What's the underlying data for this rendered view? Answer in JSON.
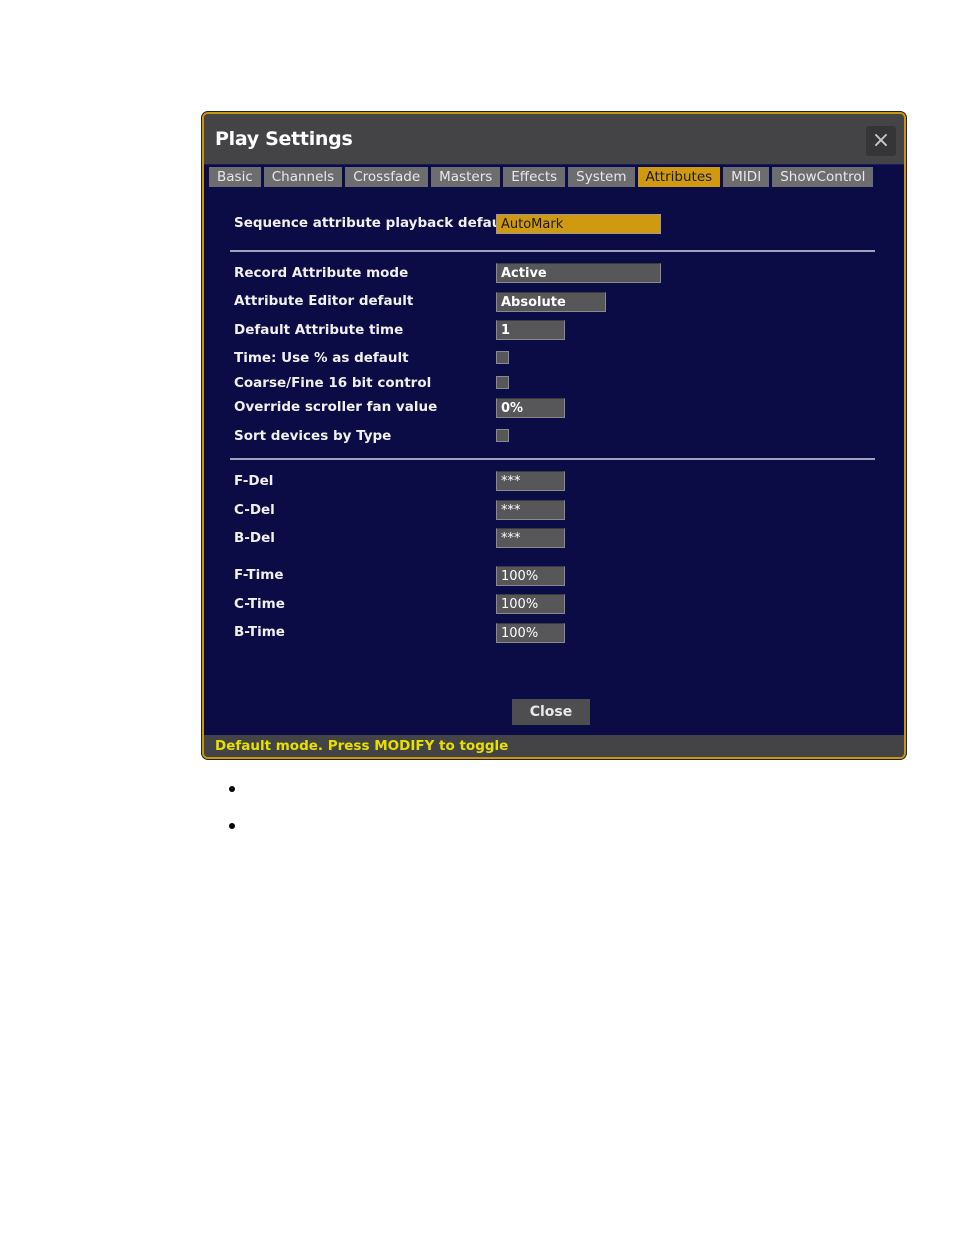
{
  "dialog": {
    "title": "Play Settings",
    "close_icon": "×",
    "tabs": [
      {
        "label": "Basic",
        "active": false
      },
      {
        "label": "Channels",
        "active": false
      },
      {
        "label": "Crossfade",
        "active": false
      },
      {
        "label": "Masters",
        "active": false
      },
      {
        "label": "Effects",
        "active": false
      },
      {
        "label": "System",
        "active": false
      },
      {
        "label": "Attributes",
        "active": true
      },
      {
        "label": "MIDI",
        "active": false
      },
      {
        "label": "ShowControl",
        "active": false
      }
    ],
    "settings": {
      "sequence_playback_default": {
        "label": "Sequence attribute playback default",
        "value": "AutoMark"
      },
      "record_attribute_mode": {
        "label": "Record Attribute mode",
        "value": "Active"
      },
      "attribute_editor_default": {
        "label": "Attribute Editor default",
        "value": "Absolute"
      },
      "default_attribute_time": {
        "label": "Default Attribute time",
        "value": "1"
      },
      "time_use_percent": {
        "label": "Time: Use % as default",
        "checked": false
      },
      "coarse_fine": {
        "label": "Coarse/Fine 16 bit control",
        "checked": false
      },
      "override_scroller_fan": {
        "label": "Override scroller fan value",
        "value": "0%"
      },
      "sort_devices": {
        "label": "Sort devices by Type",
        "checked": false
      },
      "f_del": {
        "label": "F-Del",
        "value": "***"
      },
      "c_del": {
        "label": "C-Del",
        "value": "***"
      },
      "b_del": {
        "label": "B-Del",
        "value": "***"
      },
      "f_time": {
        "label": "F-Time",
        "value": "100%"
      },
      "c_time": {
        "label": "C-Time",
        "value": "100%"
      },
      "b_time": {
        "label": "B-Time",
        "value": "100%"
      }
    },
    "close_button": "Close",
    "status": "Default mode. Press MODIFY to toggle"
  },
  "colors": {
    "accent": "#d09a10",
    "background": "#0b0b45",
    "status_text": "#e8e000"
  }
}
